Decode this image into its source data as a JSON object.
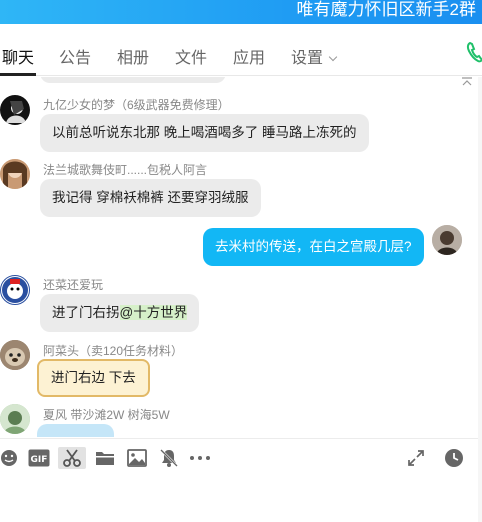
{
  "window": {
    "title": "唯有魔力怀旧区新手2群"
  },
  "tabs": [
    {
      "label": "聊天",
      "active": true
    },
    {
      "label": "公告",
      "active": false
    },
    {
      "label": "相册",
      "active": false
    },
    {
      "label": "文件",
      "active": false
    },
    {
      "label": "应用",
      "active": false
    },
    {
      "label": "设置",
      "active": false
    }
  ],
  "messages": [
    {
      "sender": "九亿少女的梦（6级武器免费修理）",
      "text": "以前总听说东北那 晚上喝酒喝多了 睡马路上冻死的",
      "self": false
    },
    {
      "sender": "法兰城歌舞伎町......包税人阿言",
      "text": "我记得 穿棉袄棉裤 还要穿羽绒服",
      "self": false
    },
    {
      "sender": "",
      "text": "去米村的传送，在白之宫殿几层?",
      "self": true
    },
    {
      "sender": "还菜还爱玩",
      "text_before": "进了门右拐",
      "mention": "@十方世界",
      "self": false
    },
    {
      "sender": "阿菜头（卖120任务材料）",
      "text": "进门右边 下去",
      "self": false
    },
    {
      "sender": "夏风 带沙滩2W  树海5W",
      "text": "",
      "self": false
    }
  ],
  "toolbar": {
    "icons": [
      "emoji-icon",
      "gif-icon",
      "scissors-icon",
      "folder-icon",
      "image-icon",
      "mute-bell-icon",
      "more-icon",
      "expand-icon",
      "history-clock-icon"
    ],
    "gif_label": "GIF"
  },
  "colors": {
    "title_bar": "#1f9cf3",
    "self_bubble": "#12b7f5",
    "bubble": "#ebebeb",
    "mention_bg": "#d6f0c9"
  }
}
